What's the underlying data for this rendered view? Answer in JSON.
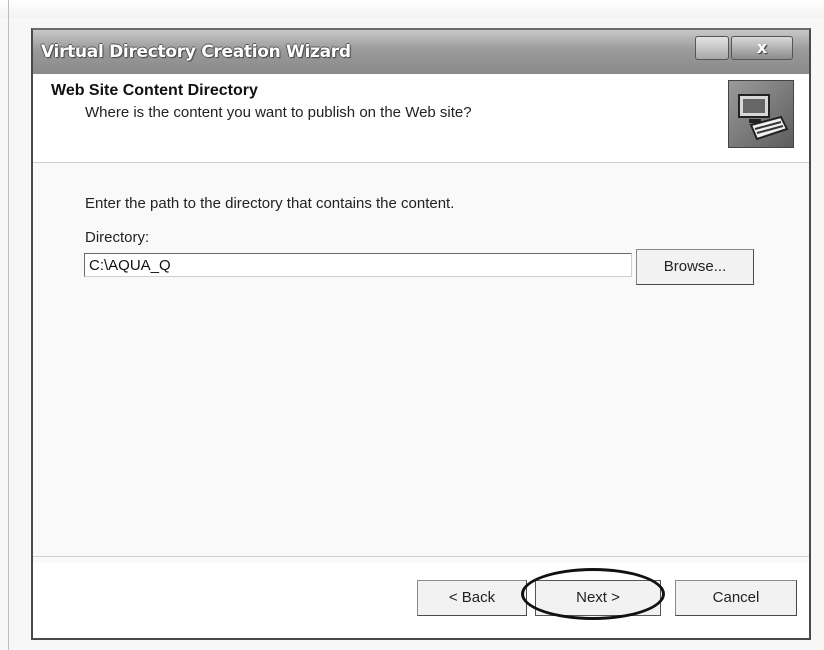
{
  "window": {
    "title": "Virtual Directory Creation Wizard",
    "close_glyph": "x"
  },
  "header": {
    "title": "Web Site Content Directory",
    "subtitle": "Where is the content you want to publish on the Web site?",
    "icon": "wizard-directory-icon"
  },
  "content": {
    "instruction": "Enter the path to the directory that contains the content.",
    "directory_label": "Directory:",
    "directory_value": "C:\\AQUA_Q",
    "browse_label": "Browse..."
  },
  "footer": {
    "back_label": "< Back",
    "next_label": "Next >",
    "cancel_label": "Cancel"
  },
  "colors": {
    "titlebar": "#9a9a9a",
    "window_bg": "#ffffff",
    "highlight_ring": "#111111"
  }
}
